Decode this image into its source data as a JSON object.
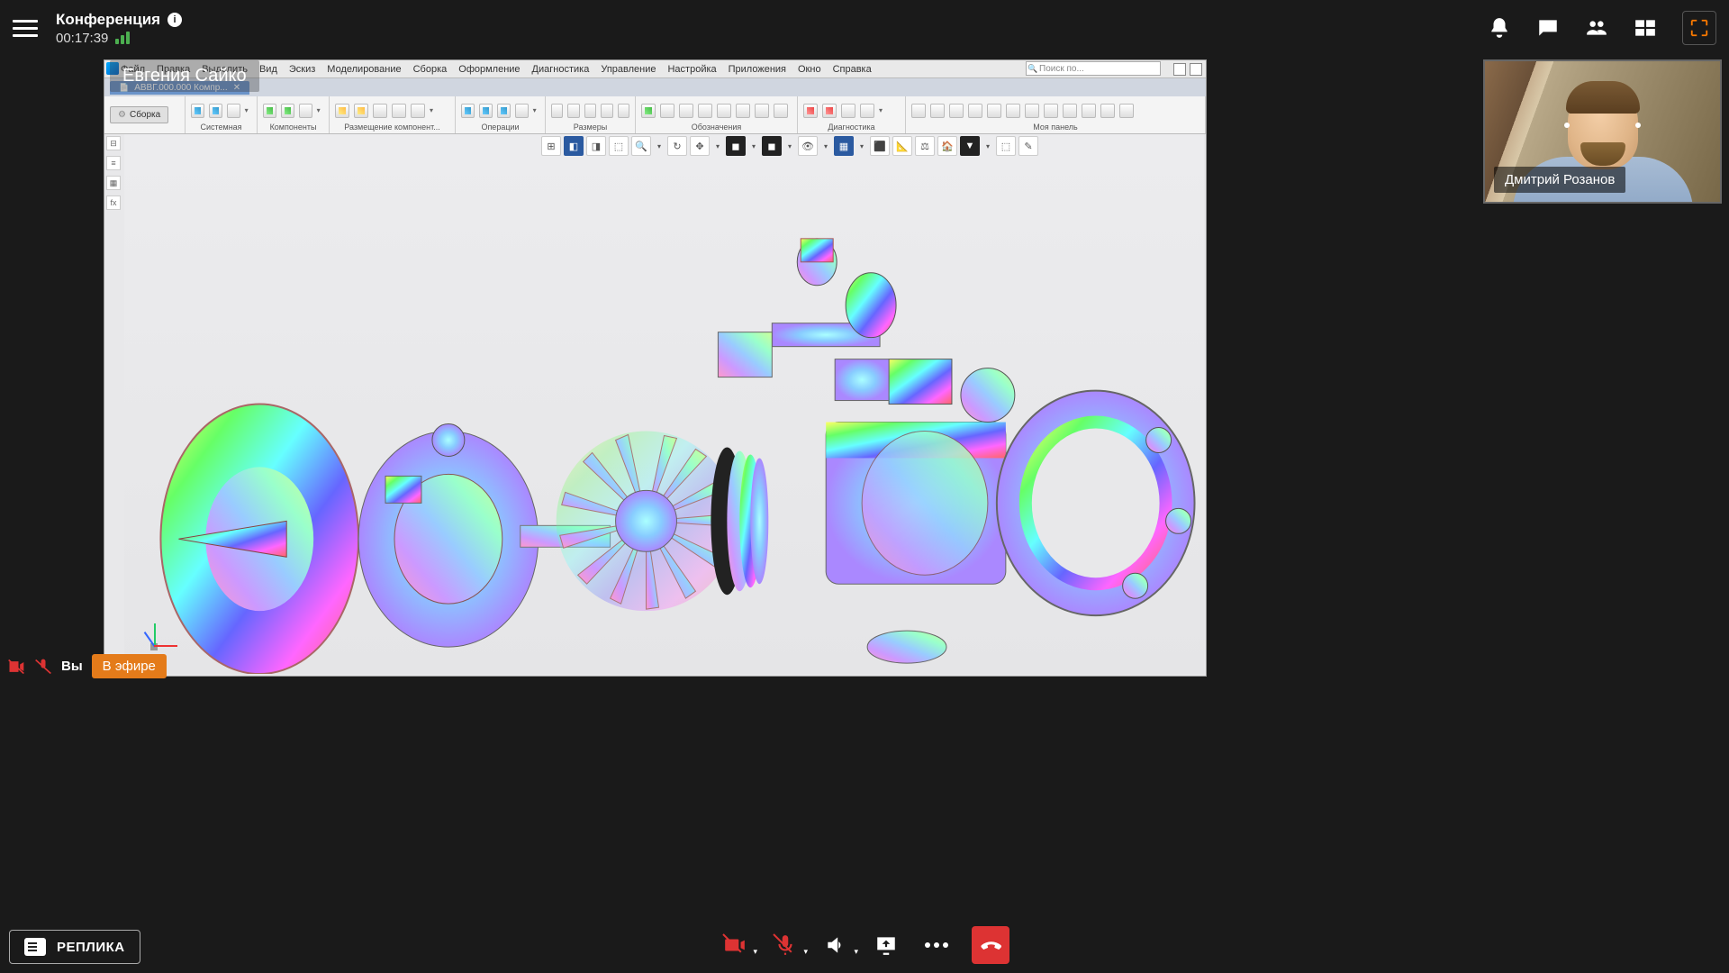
{
  "header": {
    "title": "Конференция",
    "duration": "00:17:39",
    "info_glyph": "i"
  },
  "presenter": {
    "name": "Евгения Сайко"
  },
  "participant": {
    "name": "Дмитрий Розанов"
  },
  "self": {
    "label": "Вы",
    "live_badge": "В эфире"
  },
  "replica": {
    "label": "РЕПЛИКА"
  },
  "cad": {
    "menu": [
      "Файл",
      "Правка",
      "Выделить",
      "Вид",
      "Эскиз",
      "Моделирование",
      "Сборка",
      "Оформление",
      "Диагностика",
      "Управление",
      "Настройка",
      "Приложения",
      "Окно",
      "Справка"
    ],
    "search_placeholder": "Поиск по...",
    "tab": "АВВГ.000.000 Компр...",
    "assembly_button": "Сборка",
    "ribbon_groups": [
      "Системная",
      "Компоненты",
      "Размещение компонент...",
      "Операции",
      "Размеры",
      "Обозначения",
      "Диагностика",
      "Моя панель"
    ]
  }
}
